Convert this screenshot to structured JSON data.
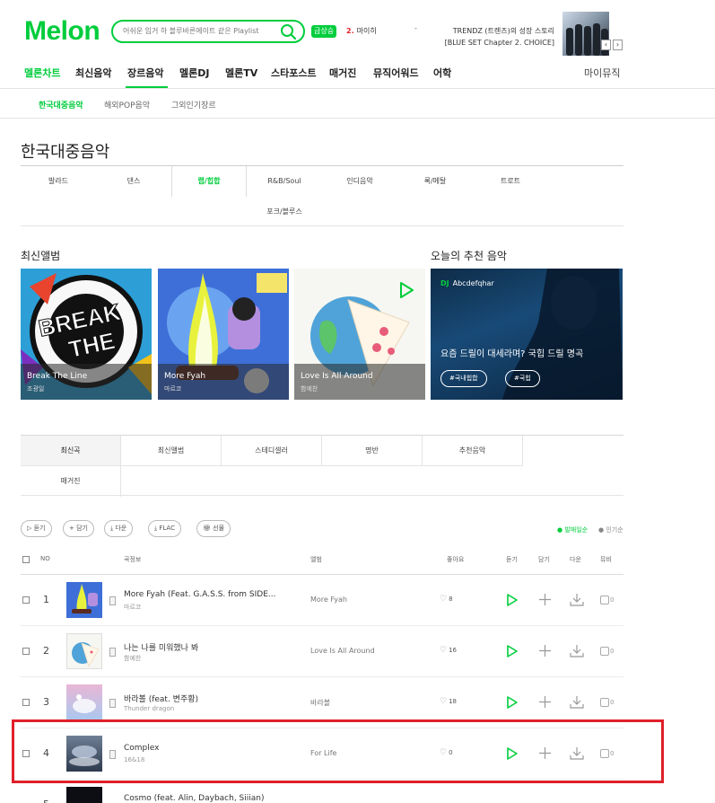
{
  "brand": {
    "logo": "Melon",
    "accent": "#00cd3c"
  },
  "search": {
    "placeholder": "어쉬운 임거 하 블루바른에이트 같은 Playlist"
  },
  "realtime": {
    "badge": "급상승",
    "rank": "2.",
    "keyword": "마이히"
  },
  "promo": {
    "dash": "-",
    "line1": "TRENDZ (트렌즈)의 성장 스토리",
    "line2": "[BLUE SET Chapter 2. CHOICE]",
    "prev": "‹",
    "next": "›"
  },
  "gnb": [
    "멜론차트",
    "최신음악",
    "장르음악",
    "멜론DJ",
    "멜론TV",
    "스타포스트",
    "매거진",
    "뮤직어워드",
    "어학"
  ],
  "my_music": "마이뮤직",
  "sub_nav": [
    "한국대중음악",
    "해외POP음악",
    "그외인기장르"
  ],
  "page_title": "한국대중음악",
  "genres": [
    "발라드",
    "댄스",
    "랩/힙합",
    "R&B/Soul",
    "인디음악",
    "록/메탈",
    "트로트",
    "포크/블루스"
  ],
  "sections": {
    "new_albums": "최신앨범",
    "today_rec": "오늘의 추천 음악"
  },
  "albums": [
    {
      "title": "Break The Line",
      "artist": "조광일"
    },
    {
      "title": "More Fyah",
      "artist": "마르코"
    },
    {
      "title": "Love Is All Around",
      "artist": "함예찬"
    }
  ],
  "recommend": {
    "dj_label": "DJ",
    "dj_name": "Abcdefqhar",
    "text": "요즘 드릴이 대세라며? 국힙 드릴 명곡",
    "tags": [
      "#국내힙합",
      "#국힙"
    ]
  },
  "tabs": [
    "최신곡",
    "최신앨범",
    "스테디셀러",
    "명반",
    "추천음악",
    "매거진"
  ],
  "actions": [
    "듣기",
    "담기",
    "다운",
    "FLAC",
    "선물"
  ],
  "sort": [
    "발매일순",
    "인기순"
  ],
  "table_headers": {
    "no": "NO",
    "song": "곡정보",
    "album": "앨범",
    "like": "좋아요",
    "play": "듣기",
    "add": "담기",
    "down": "다운",
    "mv": "뮤비"
  },
  "songs": [
    {
      "no": "1",
      "title": "More Fyah (Feat. G.A.S.S. from SIDE...",
      "artist": "마르코",
      "album": "More Fyah",
      "likes": "8",
      "mv": "0"
    },
    {
      "no": "2",
      "title": "나는 나를 미워했나 봐",
      "artist": "함예찬",
      "album": "Love Is All Around",
      "likes": "16",
      "mv": "0"
    },
    {
      "no": "3",
      "title": "바라볼 (feat. 변주황)",
      "artist": "Thunder dragon",
      "album": "바라볼",
      "likes": "18",
      "mv": "0"
    },
    {
      "no": "4",
      "title": "Complex",
      "artist": "16&18",
      "album": "For Life",
      "likes": "0",
      "mv": "0"
    },
    {
      "no": "5",
      "title": "Cosmo (feat. Alin, Daybach, Siiian)",
      "artist": "",
      "album": "",
      "likes": "",
      "mv": ""
    }
  ]
}
